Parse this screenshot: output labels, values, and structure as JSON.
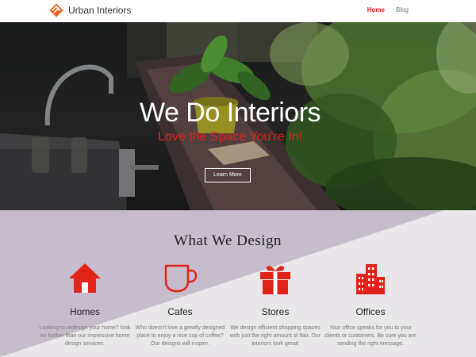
{
  "header": {
    "brand": "Urban Interiors",
    "nav": [
      {
        "label": "Home",
        "active": true
      },
      {
        "label": "Blog",
        "active": false
      }
    ],
    "accent": "#e2231a"
  },
  "hero": {
    "title": "We Do Interiors",
    "subtitle": "Love the Space You're In!",
    "button_label": "Learn More"
  },
  "section": {
    "title": "What We Design",
    "features": [
      {
        "icon": "home-icon",
        "title": "Homes",
        "description": "Looking to redesign your home? look no further than our impressive home design services."
      },
      {
        "icon": "cup-icon",
        "title": "Cafes",
        "description": "Who doesn't love a greatly designed place to enjoy a nice cup of coffee? Our designs will inspire."
      },
      {
        "icon": "gift-icon",
        "title": "Stores",
        "description": "We design efficient shopping spaces with just the right amount of flair. Our interiors look great!"
      },
      {
        "icon": "building-icon",
        "title": "Offices",
        "description": "Your office speaks for you to your clients or customers. Be sure you are sending the right message."
      }
    ]
  }
}
